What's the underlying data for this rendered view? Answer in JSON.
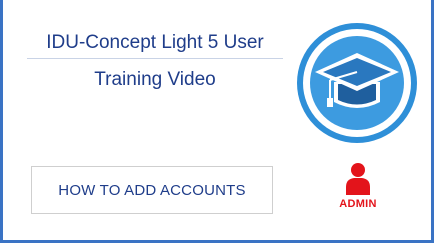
{
  "title": {
    "line1": "IDU-Concept Light 5 User",
    "line2": "Training Video"
  },
  "topic": {
    "label": "HOW TO ADD ACCOUNTS"
  },
  "badge": {
    "label": "ADMIN"
  },
  "icons": {
    "logo": "graduation-cap-icon",
    "user": "user-icon"
  },
  "colors": {
    "frame": "#3a73c4",
    "text": "#1f3d8a",
    "cap_ring": "#2e8fd8",
    "admin": "#e3141b"
  }
}
